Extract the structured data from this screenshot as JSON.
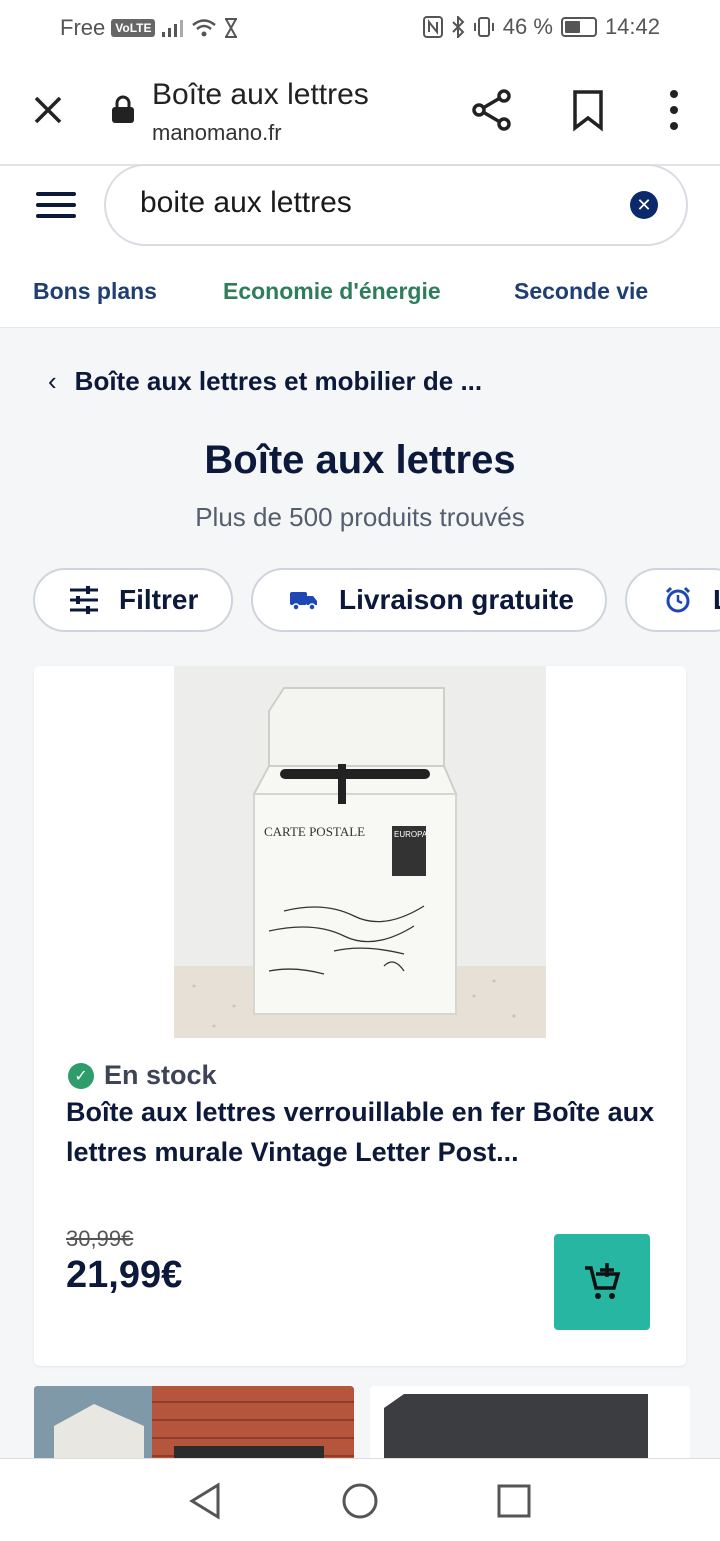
{
  "status_bar": {
    "carrier": "Free",
    "volte": "VoLTE",
    "battery": "46 %",
    "time": "14:42"
  },
  "browser": {
    "title": "Boîte aux lettres",
    "url": "manomano.fr"
  },
  "search": {
    "value": "boite aux lettres"
  },
  "nav_tabs": [
    {
      "label": "Bons plans",
      "color": "#1f3f73"
    },
    {
      "label": "Economie d'énergie",
      "color": "#2e7d5b"
    },
    {
      "label": "Seconde vie",
      "color": "#1f3f73"
    }
  ],
  "breadcrumb": "Boîte aux lettres et mobilier de ...",
  "page": {
    "title": "Boîte aux lettres",
    "results": "Plus de 500 produits trouvés"
  },
  "chips": [
    {
      "label": "Filtrer",
      "icon": "sliders-icon"
    },
    {
      "label": "Livraison gratuite",
      "icon": "truck-icon"
    },
    {
      "label": "L",
      "icon": "alarm-clock-icon"
    }
  ],
  "product": {
    "image_text": {
      "heading": "CARTE POSTALE",
      "stamp": "EUROPA"
    },
    "stock": "En stock",
    "title": "Boîte aux lettres verrouillable en fer Boîte aux lettres murale Vintage Letter Post...",
    "old_price": "30,99€",
    "price": "21,99€",
    "accent": "#26b6a2"
  }
}
